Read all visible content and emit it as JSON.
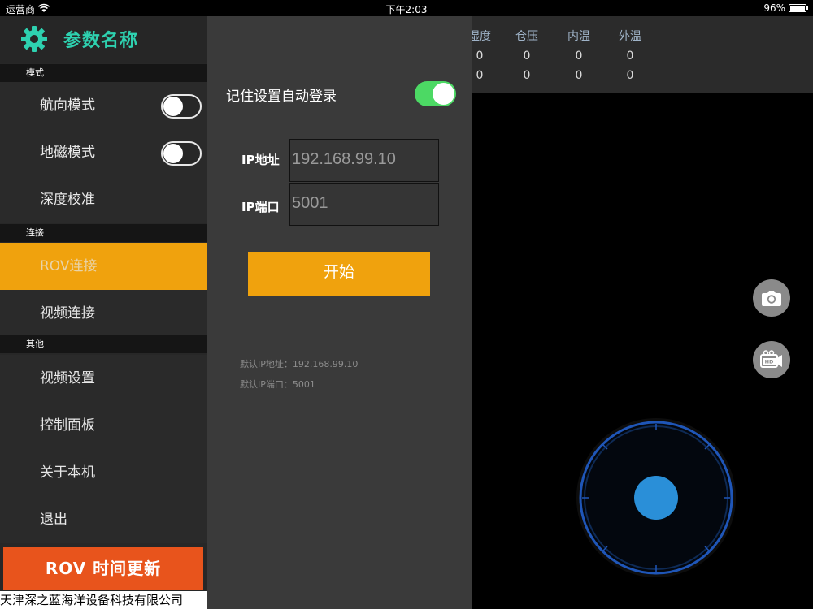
{
  "status_bar": {
    "carrier": "运营商",
    "time": "下午2:03",
    "battery": "96%"
  },
  "sidebar": {
    "title": "参数名称",
    "sections": {
      "mode": "模式",
      "connect": "连接",
      "other": "其他"
    },
    "items": {
      "heading_mode": "航向模式",
      "geomag_mode": "地磁模式",
      "depth_calib": "深度校准",
      "rov_connect": "ROV连接",
      "video_connect": "视频连接",
      "video_settings": "视频设置",
      "control_panel": "控制面板",
      "about": "关于本机",
      "exit": "退出"
    },
    "update_button": "ROV 时间更新",
    "company": "天津深之蓝海洋设备科技有限公司"
  },
  "panel": {
    "remember_label": "记住设置自动登录",
    "remember_on": true,
    "ip_label": "IP地址",
    "ip_value": "192.168.99.10",
    "port_label": "IP端口",
    "port_value": "5001",
    "start_button": "开始",
    "default_ip": "默认IP地址：192.168.99.10",
    "default_port": "默认IP端口：5001"
  },
  "telemetry": {
    "headers": [
      "湿度",
      "仓压",
      "内温",
      "外温"
    ],
    "row1": [
      "0",
      "0",
      "0",
      "0"
    ],
    "row2": [
      "0",
      "0",
      "0",
      "0"
    ]
  },
  "icons": {
    "settings": "gear-icon",
    "photo": "camera-icon",
    "record": "hd-video-icon",
    "wifi": "wifi-icon"
  },
  "colors": {
    "accent": "#f0a20d",
    "title": "#2ed1b0",
    "update_button": "#e8541c",
    "toggle_on": "#4cd964",
    "joystick": "#2a8fd8"
  }
}
